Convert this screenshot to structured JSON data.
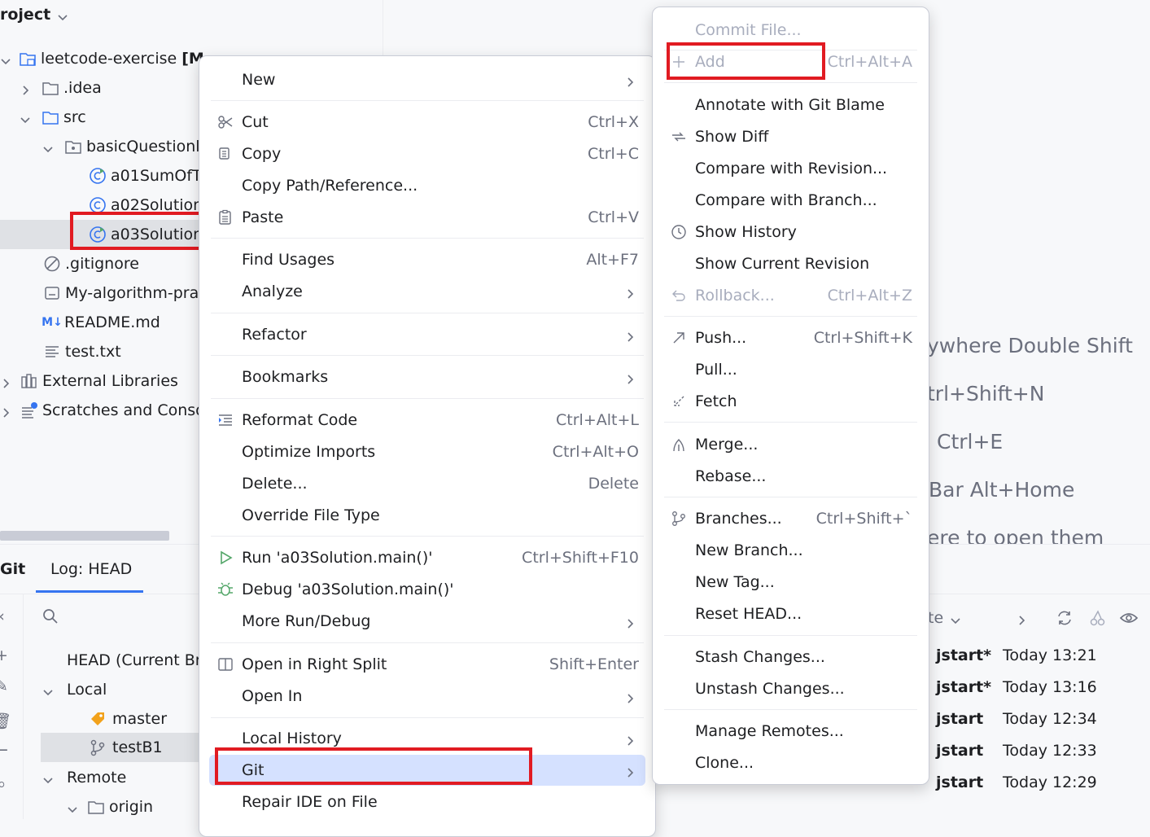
{
  "project": {
    "title": "roject",
    "tree": [
      {
        "label": "leetcode-exercise",
        "suffix": "[M",
        "bold_part": true
      },
      {
        "label": ".idea"
      },
      {
        "label": "src"
      },
      {
        "label": "basicQuestionl"
      },
      {
        "label": "a01SumOfT"
      },
      {
        "label": "a02Solution"
      },
      {
        "label": "a03Solution"
      },
      {
        "label": ".gitignore"
      },
      {
        "label": "My-algorithm-pra"
      },
      {
        "label": "README.md"
      },
      {
        "label": "test.txt"
      },
      {
        "label": "External Libraries"
      },
      {
        "label": "Scratches and Conso"
      }
    ]
  },
  "editor_hints": {
    "h1": "ywhere Double Shift",
    "h2": "trl+Shift+N",
    "h3": "Ctrl+E",
    "h4": "Bar Alt+Home",
    "h5": "ere to open them"
  },
  "git_panel": {
    "tab_git": "Git",
    "tab_log": "Log: HEAD",
    "branches": {
      "head": "HEAD (Current Br",
      "local": "Local",
      "master": "master",
      "testB1": "testB1",
      "remote": "Remote",
      "origin": "origin"
    },
    "log_filter": "te",
    "log": [
      {
        "author": "jstart*",
        "time": "Today 13:21"
      },
      {
        "author": "jstart*",
        "time": "Today 13:16"
      },
      {
        "author": "jstart",
        "time": "Today 12:34"
      },
      {
        "author": "jstart",
        "time": "Today 12:33"
      },
      {
        "author": "jstart",
        "time": "Today 12:29"
      }
    ]
  },
  "main_menu": {
    "new": "New",
    "cut": "Cut",
    "cut_sc": "Ctrl+X",
    "copy": "Copy",
    "copy_sc": "Ctrl+C",
    "copy_path": "Copy Path/Reference...",
    "paste": "Paste",
    "paste_sc": "Ctrl+V",
    "find_usages": "Find Usages",
    "find_usages_sc": "Alt+F7",
    "analyze": "Analyze",
    "refactor": "Refactor",
    "bookmarks": "Bookmarks",
    "reformat": "Reformat Code",
    "reformat_sc": "Ctrl+Alt+L",
    "optimize": "Optimize Imports",
    "optimize_sc": "Ctrl+Alt+O",
    "delete": "Delete...",
    "delete_sc": "Delete",
    "override": "Override File Type",
    "run": "Run 'a03Solution.main()'",
    "run_sc": "Ctrl+Shift+F10",
    "debug": "Debug 'a03Solution.main()'",
    "more_run": "More Run/Debug",
    "open_right": "Open in Right Split",
    "open_right_sc": "Shift+Enter",
    "open_in": "Open In",
    "local_history": "Local History",
    "git": "Git",
    "repair": "Repair IDE on File"
  },
  "git_menu": {
    "commit_file": "Commit File...",
    "add": "Add",
    "add_sc": "Ctrl+Alt+A",
    "annotate": "Annotate with Git Blame",
    "show_diff": "Show Diff",
    "compare_rev": "Compare with Revision...",
    "compare_branch": "Compare with Branch...",
    "show_history": "Show History",
    "show_current": "Show Current Revision",
    "rollback": "Rollback...",
    "rollback_sc": "Ctrl+Alt+Z",
    "push": "Push...",
    "push_sc": "Ctrl+Shift+K",
    "pull": "Pull...",
    "fetch": "Fetch",
    "merge": "Merge...",
    "rebase": "Rebase...",
    "branches": "Branches...",
    "branches_sc": "Ctrl+Shift+`",
    "new_branch": "New Branch...",
    "new_tag": "New Tag...",
    "reset_head": "Reset HEAD...",
    "stash": "Stash Changes...",
    "unstash": "Unstash Changes...",
    "manage_remotes": "Manage Remotes...",
    "clone": "Clone..."
  },
  "colors": {
    "highlight_box": "#e11b22",
    "selection": "#d5e1ff",
    "disabled_text": "#a8adbd"
  }
}
